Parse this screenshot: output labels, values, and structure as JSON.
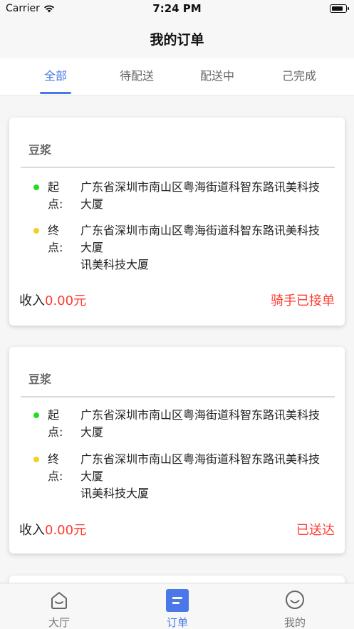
{
  "status_bar": {
    "carrier": "Carrier",
    "time": "7:24 PM",
    "battery_level": 0.8
  },
  "nav": {
    "title": "我的订单"
  },
  "tabs": [
    {
      "label": "全部",
      "active": true
    },
    {
      "label": "待配送",
      "active": false
    },
    {
      "label": "配送中",
      "active": false
    },
    {
      "label": "己完成",
      "active": false
    }
  ],
  "orders": [
    {
      "title": "豆浆",
      "start_label": "起点:",
      "start_address": "广东省深圳市南山区粤海街道科智东路讯美科技大厦",
      "end_label": "终点:",
      "end_address_line1": "广东省深圳市南山区粤海街道科智东路讯美科技大厦",
      "end_address_line2": "讯美科技大厦",
      "income_label": "收入",
      "income_value": "0.00元",
      "status": "骑手已接单"
    },
    {
      "title": "豆浆",
      "start_label": "起点:",
      "start_address": "广东省深圳市南山区粤海街道科智东路讯美科技大厦",
      "end_label": "终点:",
      "end_address_line1": "广东省深圳市南山区粤海街道科智东路讯美科技大厦",
      "end_address_line2": "讯美科技大厦",
      "income_label": "收入",
      "income_value": "0.00元",
      "status": "已送达"
    }
  ],
  "tabbar": [
    {
      "label": "大厅",
      "icon": "home-icon",
      "active": false
    },
    {
      "label": "订单",
      "icon": "order-icon",
      "active": true
    },
    {
      "label": "我的",
      "icon": "smile-icon",
      "active": false
    }
  ],
  "colors": {
    "accent": "#4a78e8",
    "alert": "#ff3b30",
    "start_dot": "#22dd22",
    "end_dot": "#f5d020"
  }
}
